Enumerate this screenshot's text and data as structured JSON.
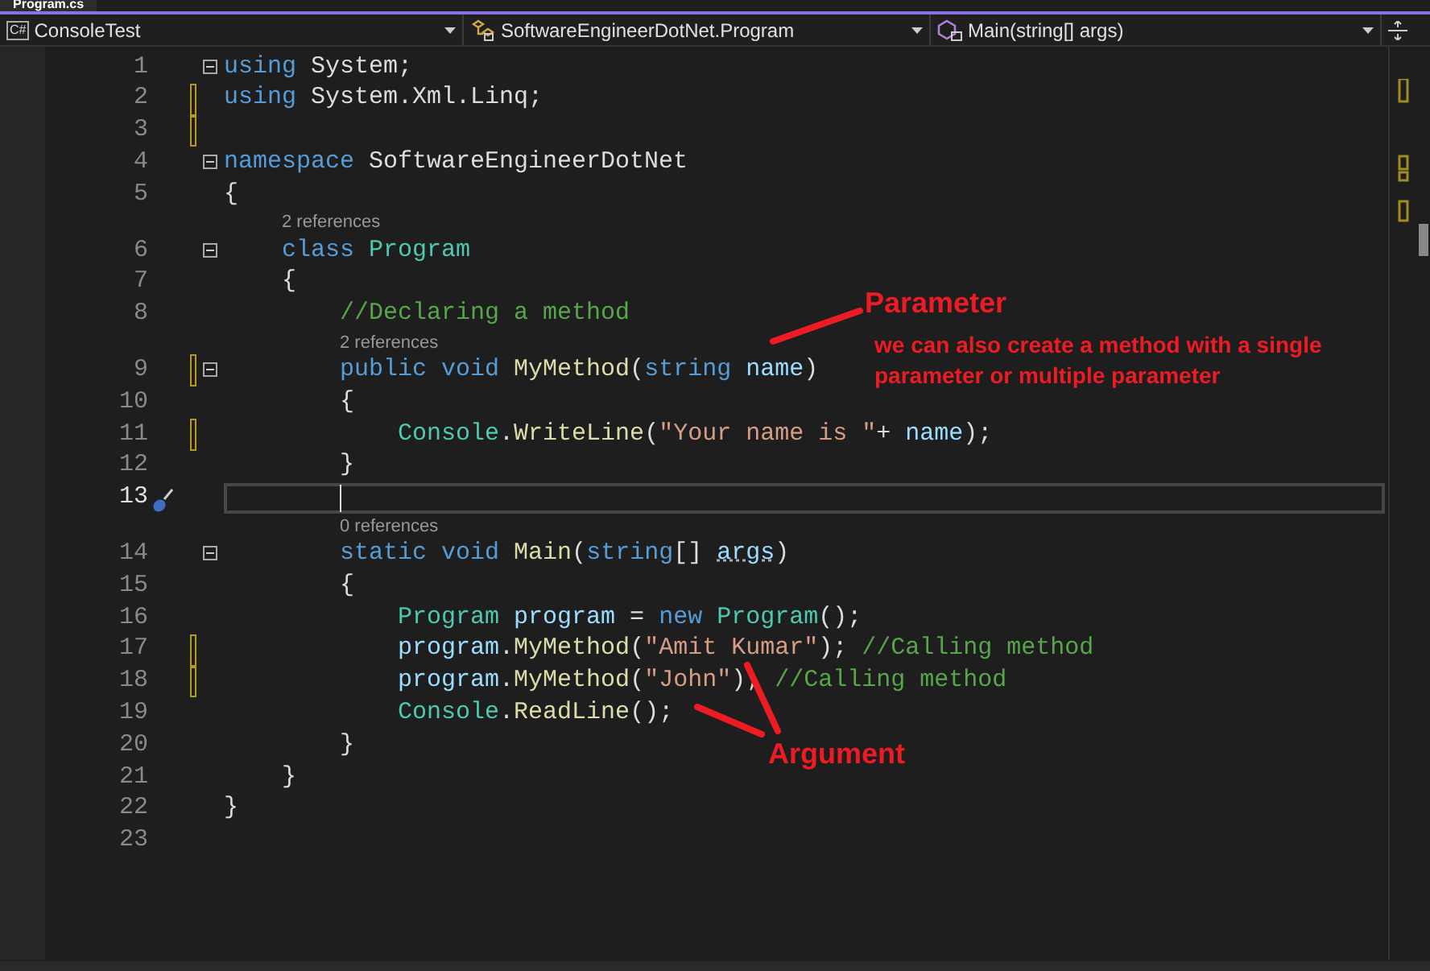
{
  "tab": {
    "label": "Program.cs",
    "selected": true
  },
  "navbar": {
    "project_icon": "C#",
    "project": "ConsoleTest",
    "type": "SoftwareEngineerDotNet.Program",
    "member": "Main(string[] args)"
  },
  "lines": [
    {
      "kind": "code",
      "number": "1",
      "changed": false,
      "fold": true,
      "current": false,
      "tokens": [
        {
          "kind": "kw",
          "text": "using"
        },
        {
          "kind": "plain",
          "text": " System;"
        }
      ]
    },
    {
      "kind": "code",
      "number": "2",
      "changed": true,
      "fold": false,
      "current": false,
      "tokens": [
        {
          "kind": "kw",
          "text": "using"
        },
        {
          "kind": "plain",
          "text": " System.Xml.Linq;"
        }
      ]
    },
    {
      "kind": "code",
      "number": "3",
      "changed": true,
      "fold": false,
      "current": false
    },
    {
      "kind": "code",
      "number": "4",
      "changed": false,
      "fold": true,
      "current": false,
      "tokens": [
        {
          "kind": "kw",
          "text": "namespace"
        },
        {
          "kind": "plain",
          "text": " SoftwareEngineerDotNet"
        }
      ]
    },
    {
      "kind": "code",
      "number": "5",
      "changed": false,
      "fold": false,
      "current": false,
      "tokens": [
        {
          "kind": "plain",
          "text": "{"
        }
      ]
    },
    {
      "kind": "lens",
      "text": "2 references"
    },
    {
      "kind": "code",
      "number": "6",
      "changed": false,
      "fold": true,
      "current": false,
      "tokens": [
        {
          "kind": "kw",
          "text": "    class"
        },
        {
          "kind": "type",
          "text": " Program"
        }
      ]
    },
    {
      "kind": "code",
      "number": "7",
      "changed": false,
      "fold": false,
      "current": false,
      "tokens": [
        {
          "kind": "plain",
          "text": "    {"
        }
      ]
    },
    {
      "kind": "code",
      "number": "8",
      "changed": false,
      "fold": false,
      "current": false,
      "tokens": [
        {
          "kind": "comment",
          "text": "        //Declaring a method"
        }
      ]
    },
    {
      "kind": "lens",
      "text": "2 references"
    },
    {
      "kind": "code",
      "number": "9",
      "changed": true,
      "fold": true,
      "current": false,
      "tokens": [
        {
          "kind": "kw",
          "text": "        public void"
        },
        {
          "kind": "method",
          "text": " MyMethod"
        },
        {
          "kind": "plain",
          "text": "("
        },
        {
          "kind": "kw",
          "text": "string"
        },
        {
          "kind": "param",
          "text": " name"
        },
        {
          "kind": "plain",
          "text": ")"
        }
      ]
    },
    {
      "kind": "code",
      "number": "10",
      "changed": false,
      "fold": false,
      "current": false,
      "tokens": [
        {
          "kind": "plain",
          "text": "        {"
        }
      ]
    },
    {
      "kind": "code",
      "number": "11",
      "changed": true,
      "fold": false,
      "current": false,
      "tokens": [
        {
          "kind": "type",
          "text": "            Console"
        },
        {
          "kind": "plain",
          "text": "."
        },
        {
          "kind": "method",
          "text": "WriteLine"
        },
        {
          "kind": "plain",
          "text": "("
        },
        {
          "kind": "string",
          "text": "\"Your name is \""
        },
        {
          "kind": "plain",
          "text": "+ "
        },
        {
          "kind": "param",
          "text": "name"
        },
        {
          "kind": "plain",
          "text": ");"
        }
      ]
    },
    {
      "kind": "code",
      "number": "12",
      "changed": false,
      "fold": false,
      "current": false,
      "tokens": [
        {
          "kind": "plain",
          "text": "        }"
        }
      ]
    },
    {
      "kind": "code",
      "number": "13",
      "changed": false,
      "fold": false,
      "current": true
    },
    {
      "kind": "lens",
      "text": "0 references"
    },
    {
      "kind": "code",
      "number": "14",
      "changed": false,
      "fold": true,
      "current": false,
      "tokens": [
        {
          "kind": "kw",
          "text": "        static void"
        },
        {
          "kind": "method",
          "text": " Main"
        },
        {
          "kind": "plain",
          "text": "("
        },
        {
          "kind": "kw",
          "text": "string"
        },
        {
          "kind": "plain",
          "text": "[] "
        },
        {
          "kind": "hint",
          "text": "args"
        },
        {
          "kind": "plain",
          "text": ")"
        }
      ]
    },
    {
      "kind": "code",
      "number": "15",
      "changed": false,
      "fold": false,
      "current": false,
      "tokens": [
        {
          "kind": "plain",
          "text": "        {"
        }
      ]
    },
    {
      "kind": "code",
      "number": "16",
      "changed": false,
      "fold": false,
      "current": false,
      "tokens": [
        {
          "kind": "type",
          "text": "            Program"
        },
        {
          "kind": "param",
          "text": " program"
        },
        {
          "kind": "plain",
          "text": " = "
        },
        {
          "kind": "kw",
          "text": "new"
        },
        {
          "kind": "type",
          "text": " Program"
        },
        {
          "kind": "plain",
          "text": "();"
        }
      ]
    },
    {
      "kind": "code",
      "number": "17",
      "changed": true,
      "fold": false,
      "current": false,
      "tokens": [
        {
          "kind": "param",
          "text": "            program"
        },
        {
          "kind": "plain",
          "text": "."
        },
        {
          "kind": "method",
          "text": "MyMethod"
        },
        {
          "kind": "plain",
          "text": "("
        },
        {
          "kind": "string",
          "text": "\"Amit Kumar\""
        },
        {
          "kind": "plain",
          "text": "); "
        },
        {
          "kind": "comment",
          "text": "//Calling method"
        }
      ]
    },
    {
      "kind": "code",
      "number": "18",
      "changed": true,
      "fold": false,
      "current": false,
      "tokens": [
        {
          "kind": "param",
          "text": "            program"
        },
        {
          "kind": "plain",
          "text": "."
        },
        {
          "kind": "method",
          "text": "MyMethod"
        },
        {
          "kind": "plain",
          "text": "("
        },
        {
          "kind": "string",
          "text": "\"John\""
        },
        {
          "kind": "plain",
          "text": "); "
        },
        {
          "kind": "comment",
          "text": "//Calling method"
        }
      ]
    },
    {
      "kind": "code",
      "number": "19",
      "changed": false,
      "fold": false,
      "current": false,
      "tokens": [
        {
          "kind": "type",
          "text": "            Console"
        },
        {
          "kind": "plain",
          "text": "."
        },
        {
          "kind": "method",
          "text": "ReadLine"
        },
        {
          "kind": "plain",
          "text": "();"
        }
      ]
    },
    {
      "kind": "code",
      "number": "20",
      "changed": false,
      "fold": false,
      "current": false,
      "tokens": [
        {
          "kind": "plain",
          "text": "        }"
        }
      ]
    },
    {
      "kind": "code",
      "number": "21",
      "changed": false,
      "fold": false,
      "current": false,
      "tokens": [
        {
          "kind": "plain",
          "text": "    }"
        }
      ]
    },
    {
      "kind": "code",
      "number": "22",
      "changed": false,
      "fold": false,
      "current": false,
      "tokens": [
        {
          "kind": "plain",
          "text": "}"
        }
      ]
    },
    {
      "kind": "code",
      "number": "23",
      "changed": false,
      "fold": false,
      "current": false
    }
  ],
  "annotations": [
    {
      "kind": "title",
      "text": "Parameter"
    },
    {
      "kind": "note",
      "text": "we can also create a method with a single parameter or multiple parameter"
    },
    {
      "kind": "title",
      "text": "Argument"
    }
  ]
}
